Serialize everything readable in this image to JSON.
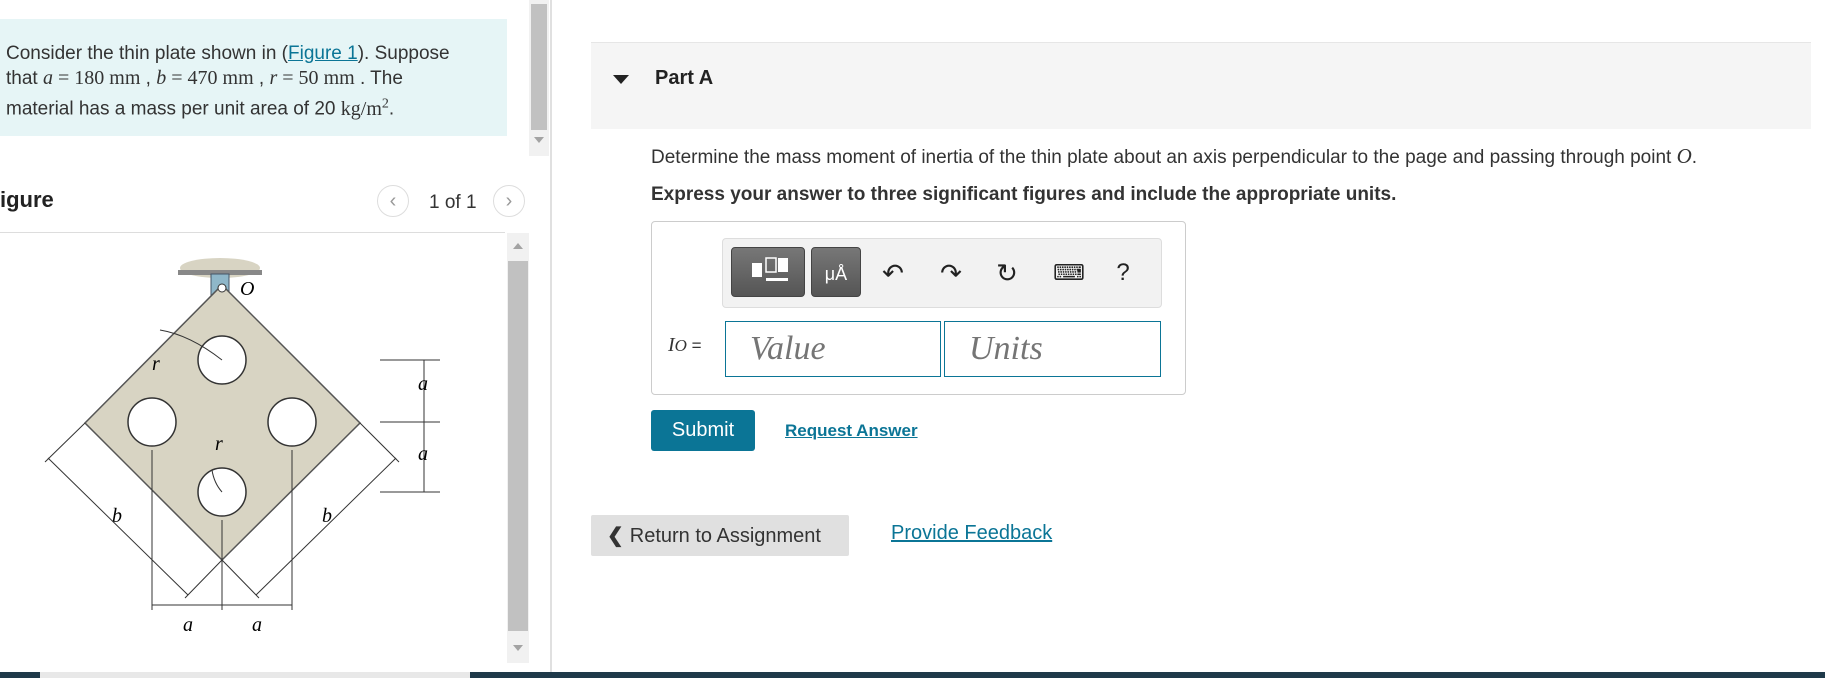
{
  "problem": {
    "text_before_link": "Consider the thin plate shown in (",
    "link": "Figure 1",
    "text_after_link": "). Suppose",
    "line2_prefix": "that ",
    "a_var": "a",
    "a_value": " = 180 ",
    "a_unit": "mm",
    "b_var": "b",
    "b_value": " = 470 ",
    "b_unit": "mm",
    "r_var": "r",
    "r_value": " = 50 ",
    "r_unit": "mm",
    "line2_suffix": ". The",
    "line3": "material has a mass per unit area of 20 ",
    "mass_unit": "kg/m",
    "exp": "2",
    "end": "."
  },
  "figure": {
    "title": "igure",
    "pager": "1 of 1",
    "labels": {
      "O": "O",
      "r": "r",
      "a": "a",
      "b": "b"
    }
  },
  "part": {
    "title": "Part A",
    "question_text": "Determine the mass moment of inertia of the thin plate about an axis perpendicular to the page and passing through point ",
    "point": "O",
    "question_end": ".",
    "instruction": "Express your answer to three significant figures and include the appropriate units."
  },
  "answer": {
    "label_var": "I",
    "label_sub": "O",
    "label_eq": " =",
    "value_placeholder": "Value",
    "units_placeholder": "Units",
    "units_icon_text": "μÅ",
    "help": "?"
  },
  "actions": {
    "submit": "Submit",
    "request": "Request Answer",
    "return": "Return to Assignment",
    "feedback": "Provide Feedback"
  },
  "colors": {
    "accent": "#0b7596",
    "problem_bg": "#e6f5f6",
    "plate": "#d8d4c3"
  }
}
